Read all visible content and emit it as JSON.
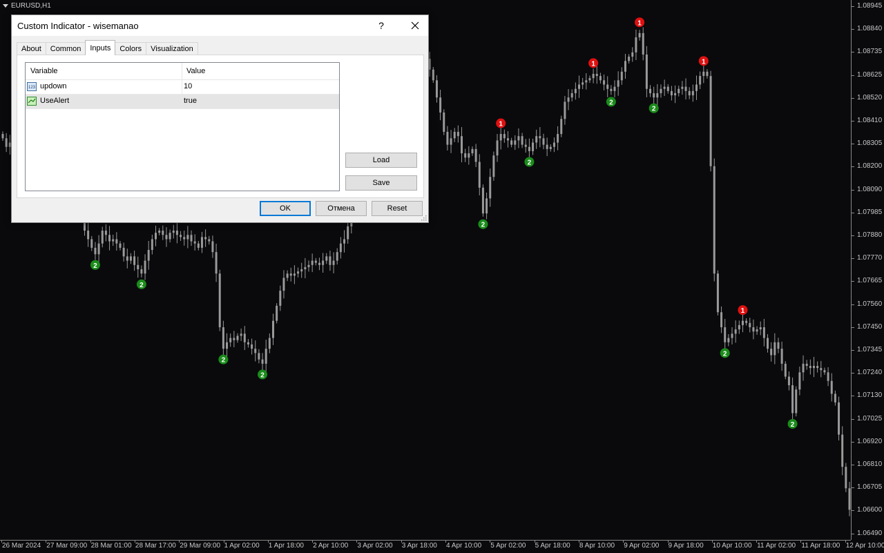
{
  "chart": {
    "symbol": "EURUSD,H1",
    "price_labels": [
      "1.08945",
      "1.08840",
      "1.08735",
      "1.08625",
      "1.08520",
      "1.08410",
      "1.08305",
      "1.08200",
      "1.08090",
      "1.07985",
      "1.07880",
      "1.07770",
      "1.07665",
      "1.07560",
      "1.07450",
      "1.07345",
      "1.07240",
      "1.07130",
      "1.07025",
      "1.06920",
      "1.06810",
      "1.06705",
      "1.06600",
      "1.06490"
    ],
    "time_labels": [
      "26 Mar 2024",
      "27 Mar 09:00",
      "28 Mar 01:00",
      "28 Mar 17:00",
      "29 Mar 09:00",
      "1 Apr 02:00",
      "1 Apr 18:00",
      "2 Apr 10:00",
      "3 Apr 02:00",
      "3 Apr 18:00",
      "4 Apr 10:00",
      "5 Apr 02:00",
      "5 Apr 18:00",
      "8 Apr 10:00",
      "9 Apr 02:00",
      "9 Apr 18:00",
      "10 Apr 10:00",
      "11 Apr 02:00",
      "11 Apr 18:00",
      "12 Apr 10:00"
    ],
    "colors": {
      "background": "#0a0a0d",
      "candle": "#9a9a9a",
      "signal_up": "#e01010",
      "signal_down": "#1a8c1a",
      "axis": "#8a8a8a",
      "text": "#c8c8c8"
    },
    "signal_labels": {
      "top": "1",
      "bottom": "2"
    },
    "close_path": [
      1.0833,
      1.0829,
      1.0831,
      1.0827,
      1.0825,
      1.0822,
      1.0824,
      1.0826,
      1.0828,
      1.0825,
      1.0823,
      1.0821,
      1.0819,
      1.0818,
      1.0816,
      1.0814,
      1.0812,
      1.081,
      1.0808,
      1.0806,
      1.0804,
      1.08,
      1.0795,
      1.079,
      1.0786,
      1.0782,
      1.0779,
      1.0784,
      1.079,
      1.0788,
      1.0785,
      1.0786,
      1.0784,
      1.0782,
      1.0778,
      1.0776,
      1.0778,
      1.0774,
      1.0772,
      1.077,
      1.0776,
      1.0781,
      1.0786,
      1.0789,
      1.079,
      1.0788,
      1.0786,
      1.0789,
      1.079,
      1.0788,
      1.0787,
      1.0786,
      1.0788,
      1.0785,
      1.0784,
      1.0782,
      1.0787,
      1.0786,
      1.0785,
      1.078,
      1.077,
      1.0745,
      1.0735,
      1.0738,
      1.074,
      1.0739,
      1.0741,
      1.0742,
      1.0738,
      1.0737,
      1.0735,
      1.0733,
      1.073,
      1.0728,
      1.0735,
      1.074,
      1.0748,
      1.0755,
      1.0762,
      1.0768,
      1.077,
      1.0769,
      1.077,
      1.0771,
      1.0772,
      1.0773,
      1.0774,
      1.0776,
      1.0775,
      1.0774,
      1.0776,
      1.0778,
      1.0774,
      1.0776,
      1.078,
      1.0784,
      1.0786,
      1.0792,
      1.08,
      1.0812,
      1.0825,
      1.0835,
      1.0842,
      1.0846,
      1.085,
      1.0845,
      1.0843,
      1.0842,
      1.084,
      1.0844,
      1.0848,
      1.0856,
      1.0862,
      1.086,
      1.0859,
      1.0862,
      1.0868,
      1.0872,
      1.0875,
      1.087,
      1.0865,
      1.086,
      1.0852,
      1.0845,
      1.0836,
      1.083,
      1.0833,
      1.0836,
      1.0834,
      1.0826,
      1.0824,
      1.0826,
      1.0828,
      1.0822,
      1.081,
      1.0798,
      1.0805,
      1.0815,
      1.0825,
      1.0832,
      1.0835,
      1.0833,
      1.0832,
      1.083,
      1.0832,
      1.0834,
      1.083,
      1.0829,
      1.0827,
      1.0831,
      1.0834,
      1.0833,
      1.083,
      1.0828,
      1.0829,
      1.0831,
      1.0835,
      1.0842,
      1.085,
      1.0852,
      1.0854,
      1.0856,
      1.0858,
      1.0859,
      1.086,
      1.0861,
      1.0863,
      1.0862,
      1.086,
      1.0858,
      1.0856,
      1.0855,
      1.0857,
      1.086,
      1.0864,
      1.0869,
      1.0871,
      1.0873,
      1.088,
      1.0882,
      1.0872,
      1.0856,
      1.0854,
      1.0852,
      1.0854,
      1.0856,
      1.0857,
      1.0855,
      1.0853,
      1.0854,
      1.0856,
      1.0857,
      1.0855,
      1.0853,
      1.0855,
      1.0858,
      1.0862,
      1.0864,
      1.0862,
      1.082,
      1.077,
      1.0752,
      1.0745,
      1.0738,
      1.074,
      1.0742,
      1.0744,
      1.0746,
      1.0748,
      1.0747,
      1.0745,
      1.0743,
      1.0744,
      1.0745,
      1.074,
      1.0735,
      1.0732,
      1.0738,
      1.0735,
      1.0728,
      1.0722,
      1.0718,
      1.0705,
      1.0716,
      1.0724,
      1.0728,
      1.0727,
      1.0726,
      1.0727,
      1.0726,
      1.0725,
      1.0724,
      1.072,
      1.0714,
      1.071,
      1.0695,
      1.068,
      1.067,
      1.066
    ]
  },
  "dialog": {
    "title": "Custom Indicator - wisemanao",
    "help_label": "?",
    "tabs": [
      {
        "label": "About"
      },
      {
        "label": "Common"
      },
      {
        "label": "Inputs"
      },
      {
        "label": "Colors"
      },
      {
        "label": "Visualization"
      }
    ],
    "active_tab": "Inputs",
    "table": {
      "col_variable": "Variable",
      "col_value": "Value",
      "rows": [
        {
          "variable": "updown",
          "value": "10",
          "icon": "integer-param-icon",
          "icon_text": "123"
        },
        {
          "variable": "UseAlert",
          "value": "true",
          "icon": "bool-param-icon",
          "icon_text": ""
        }
      ]
    },
    "load_label": "Load",
    "save_label": "Save",
    "ok_label": "OK",
    "cancel_label": "Отмена",
    "reset_label": "Reset"
  }
}
